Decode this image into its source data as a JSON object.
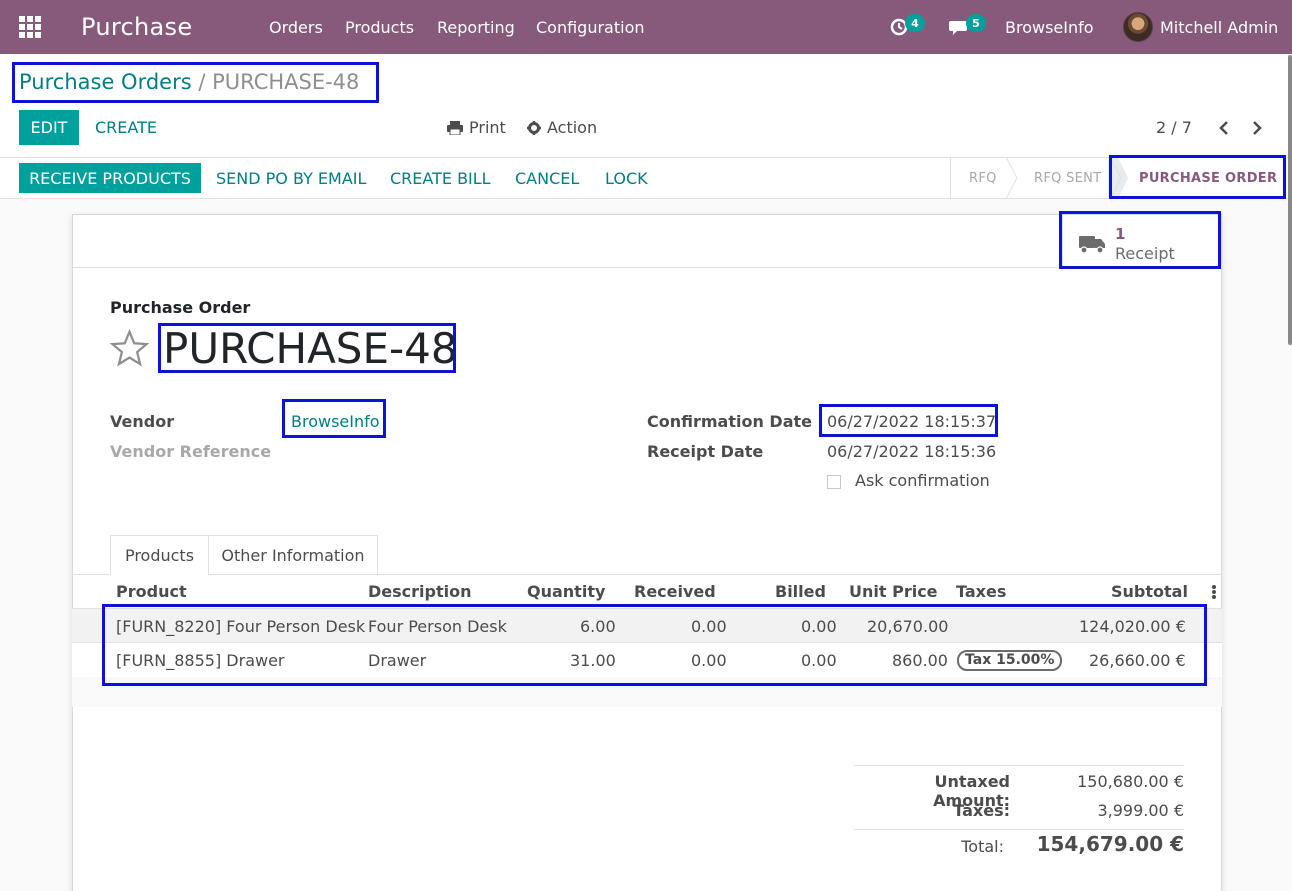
{
  "navbar": {
    "app_name": "Purchase",
    "menu": [
      "Orders",
      "Products",
      "Reporting",
      "Configuration"
    ],
    "activity_count": "4",
    "messages_count": "5",
    "company": "BrowseInfo",
    "user": "Mitchell Admin"
  },
  "breadcrumb": {
    "parent": "Purchase Orders",
    "separator": "/",
    "current": "PURCHASE-48"
  },
  "toolbar": {
    "edit": "EDIT",
    "create": "CREATE",
    "print": "Print",
    "action": "Action",
    "pager": "2 / 7"
  },
  "status_bar": {
    "buttons": [
      "RECEIVE PRODUCTS",
      "SEND PO BY EMAIL",
      "CREATE BILL",
      "CANCEL",
      "LOCK"
    ],
    "stages": [
      "RFQ",
      "RFQ SENT",
      "PURCHASE ORDER"
    ],
    "active_stage": "PURCHASE ORDER"
  },
  "smart_button": {
    "count": "1",
    "label": "Receipt"
  },
  "form": {
    "kind": "Purchase Order",
    "name": "PURCHASE-48",
    "vendor_label": "Vendor",
    "vendor_value": "BrowseInfo",
    "vendor_ref_label": "Vendor Reference",
    "confirmation_label": "Confirmation Date",
    "confirmation_value": "06/27/2022 18:15:37",
    "receipt_label": "Receipt Date",
    "receipt_value": "06/27/2022 18:15:36",
    "ask_confirmation": "Ask confirmation"
  },
  "tabs": [
    "Products",
    "Other Information"
  ],
  "table": {
    "headers": [
      "Product",
      "Description",
      "Quantity",
      "Received",
      "Billed",
      "Unit Price",
      "Taxes",
      "Subtotal"
    ],
    "rows": [
      {
        "product": "[FURN_8220] Four Person Desk",
        "description": "Four Person Desk",
        "quantity": "6.00",
        "received": "0.00",
        "billed": "0.00",
        "unit_price": "20,670.00",
        "taxes": "",
        "subtotal": "124,020.00 €"
      },
      {
        "product": "[FURN_8855] Drawer",
        "description": "Drawer",
        "quantity": "31.00",
        "received": "0.00",
        "billed": "0.00",
        "unit_price": "860.00",
        "taxes": "Tax 15.00%",
        "subtotal": "26,660.00 €"
      }
    ]
  },
  "totals": {
    "untaxed_label": "Untaxed Amount:",
    "untaxed_value": "150,680.00 €",
    "taxes_label": "Taxes:",
    "taxes_value": "3,999.00 €",
    "total_label": "Total:",
    "total_value": "154,679.00 €"
  },
  "colors": {
    "brand": "#875a7b",
    "primary": "#00a09d",
    "link": "#017e84",
    "highlight": "#0b13d6"
  }
}
